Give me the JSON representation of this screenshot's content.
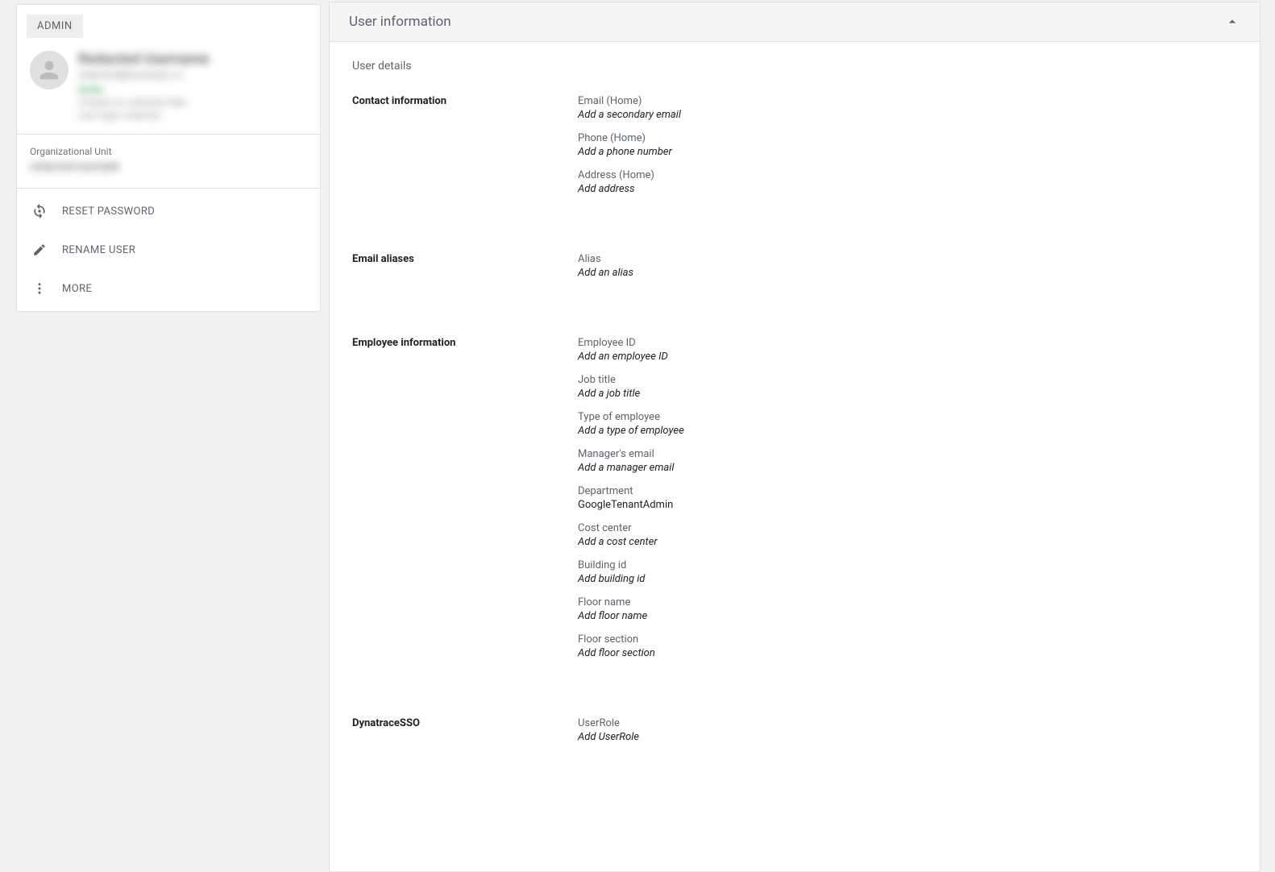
{
  "sidebar": {
    "admin_badge": "ADMIN",
    "user_name_redacted": "Redacted Username",
    "user_email_redacted": "redacted@example.co",
    "user_status_redacted": "Active",
    "user_line1_redacted": "Created on redacted date",
    "user_line2_redacted": "Last login redacted",
    "org_label": "Organizational Unit",
    "org_value_redacted": "redacted.example",
    "actions": {
      "reset_password": "RESET PASSWORD",
      "rename_user": "RENAME USER",
      "more": "MORE"
    }
  },
  "panel": {
    "title": "User information",
    "subheading": "User details",
    "sections": {
      "contact": {
        "title": "Contact information",
        "email_label": "Email (Home)",
        "email_placeholder": "Add a secondary email",
        "phone_label": "Phone (Home)",
        "phone_placeholder": "Add a phone number",
        "address_label": "Address (Home)",
        "address_placeholder": "Add address"
      },
      "aliases": {
        "title": "Email aliases",
        "alias_label": "Alias",
        "alias_placeholder": "Add an alias"
      },
      "employee": {
        "title": "Employee information",
        "employee_id_label": "Employee ID",
        "employee_id_placeholder": "Add an employee ID",
        "job_title_label": "Job title",
        "job_title_placeholder": "Add a job title",
        "employee_type_label": "Type of employee",
        "employee_type_placeholder": "Add a type of employee",
        "manager_email_label": "Manager's email",
        "manager_email_placeholder": "Add a manager email",
        "department_label": "Department",
        "department_value": "GoogleTenantAdmin",
        "cost_center_label": "Cost center",
        "cost_center_placeholder": "Add a cost center",
        "building_id_label": "Building id",
        "building_id_placeholder": "Add building id",
        "floor_name_label": "Floor name",
        "floor_name_placeholder": "Add floor name",
        "floor_section_label": "Floor section",
        "floor_section_placeholder": "Add floor section"
      },
      "dynatrace": {
        "title": "DynatraceSSO",
        "user_role_label": "UserRole",
        "user_role_placeholder": "Add UserRole"
      }
    }
  }
}
